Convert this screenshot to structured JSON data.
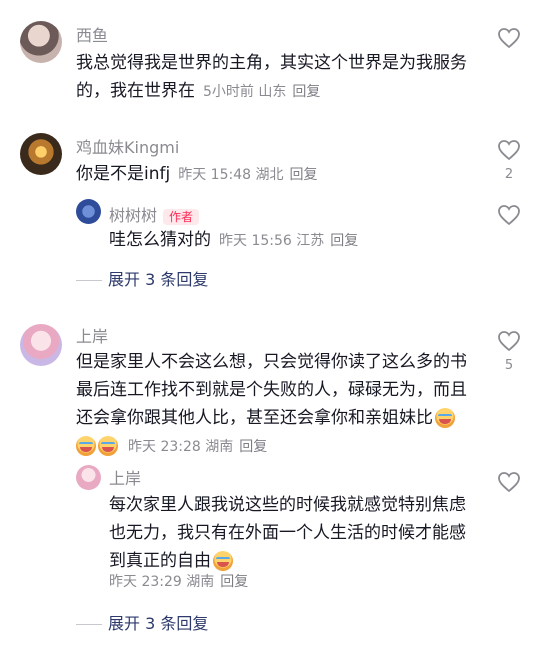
{
  "comments": [
    {
      "name": "西鱼",
      "text": "我总觉得我是世界的主角，其实这个世界是为我服务的，我在世界在",
      "time": "5小时前",
      "location": "山东",
      "reply_label": "回复"
    },
    {
      "name": "鸡血妹Kingmi",
      "text": "你是不是infj",
      "time": "昨天 15:48",
      "location": "湖北",
      "reply_label": "回复",
      "likes": "2",
      "sub_reply": {
        "name": "树树树",
        "tag": "作者",
        "text": "哇怎么猜对的",
        "time": "昨天 15:56",
        "location": "江苏",
        "reply_label": "回复"
      },
      "expand_label": "展开 3 条回复"
    },
    {
      "name": "上岸",
      "text": "但是家里人不会这么想，只会觉得你读了这么多的书最后连工作找不到就是个失败的人，碌碌无为，而且还会拿你跟其他人比，甚至还会拿你和亲姐妹比",
      "time": "昨天 23:28",
      "location": "湖南",
      "reply_label": "回复",
      "likes": "5",
      "sub_reply": {
        "name": "上岸",
        "text": "每次家里人跟我说这些的时候我就感觉特别焦虑也无力，我只有在外面一个人生活的时候才能感到真正的自由",
        "time": "昨天 23:29",
        "location": "湖南",
        "reply_label": "回复"
      },
      "expand_label": "展开 3 条回复"
    }
  ],
  "icons": {
    "like": "heart-outline-icon",
    "emoji": "crying-face-emoji-icon"
  },
  "colors": {
    "author_tag": "#fe2c55",
    "expand": "#2d3a6b",
    "meta": "#8a8b91"
  }
}
